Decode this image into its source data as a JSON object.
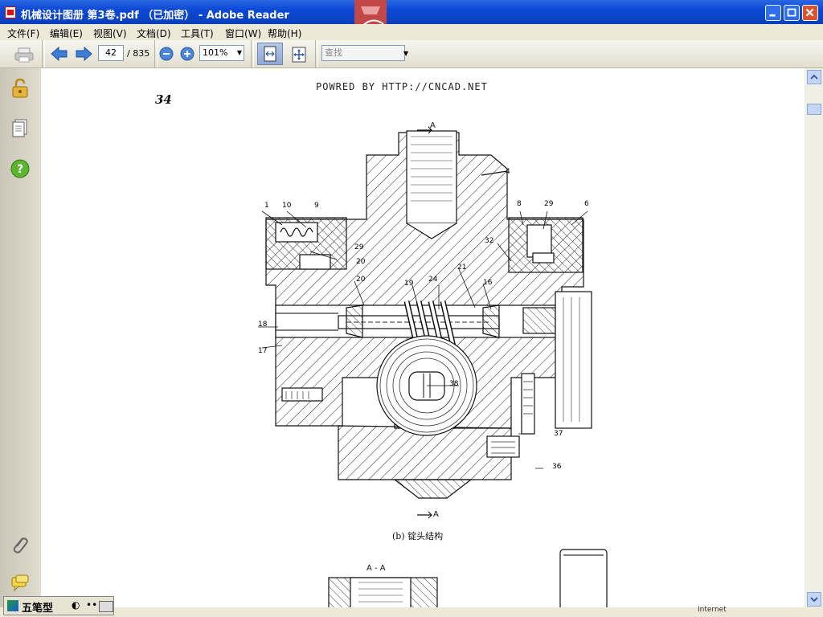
{
  "window": {
    "title": "机械设计图册  第3卷.pdf （已加密） - Adobe Reader",
    "accent": "#0b49d6"
  },
  "menu": {
    "items": [
      "文件(F)",
      "编辑(E)",
      "视图(V)",
      "文档(D)",
      "工具(T)",
      "窗口(W)",
      "帮助(H)"
    ]
  },
  "toolbar": {
    "page_current": "42",
    "page_total": "/ 835",
    "zoom": "101%",
    "search_placeholder": "查找"
  },
  "leftnav": {
    "icons": [
      "lock-icon",
      "pages-icon",
      "help-icon",
      "attachment-icon",
      "comments-icon"
    ]
  },
  "document": {
    "watermark": "POWRED BY HTTP://CNCAD.NET",
    "page_number": "34",
    "section_marker_top": "A",
    "section_marker_bottom": "A",
    "caption": "(b) 锭头结构",
    "section_label": "A - A",
    "callouts": [
      "4",
      "1",
      "10",
      "9",
      "29",
      "20",
      "20",
      "19",
      "24",
      "21",
      "16",
      "8",
      "29",
      "6",
      "32",
      "18",
      "17",
      "38",
      "37",
      "36"
    ]
  },
  "statusbar": {
    "ime_label": "五笔型",
    "zone": "Internet"
  }
}
